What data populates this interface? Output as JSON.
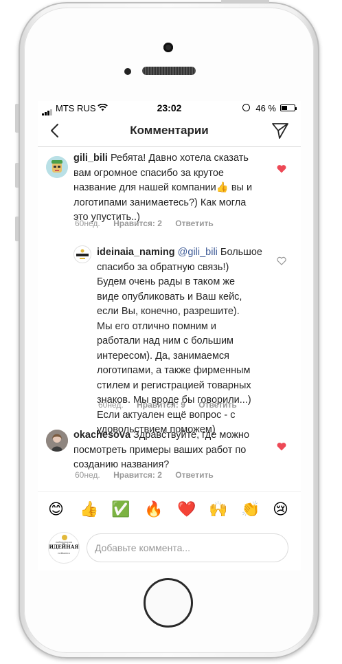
{
  "status": {
    "carrier": "MTS RUS",
    "time": "23:02",
    "battery_pct": "46 %",
    "battery_level": 0.46
  },
  "nav": {
    "title": "Комментарии",
    "back_icon": "chevron-left-icon",
    "send_icon": "paper-plane-icon"
  },
  "comments": [
    {
      "username": "gili_bili",
      "text_lines": [
        "Ребята! Давно хотела сказать",
        "вам огромное спасибо за крутое",
        "название для нашей компании",
        "логотипами занимаетесь?) Как могла",
        "это упустить..)"
      ],
      "line3_suffix": " вы и",
      "emoji": "👍",
      "age": "60нед.",
      "likes": "Нравится: 2",
      "reply": "Ответить",
      "liked": true
    },
    {
      "username": "ideinaia_naming",
      "mention": "@gili_bili",
      "first_line_rest": " Большое",
      "text_lines": [
        "спасибо за обратную связь!)",
        "Будем очень рады в таком же",
        "виде опубликовать и Ваш кейс,",
        "если Вы, конечно, разрешите).",
        "Мы его отлично помним и",
        "работали над ним с большим",
        "интересом). Да, занимаемся",
        "логотипами, а также фирменным",
        "стилем и регистрацией товарных",
        "знаков. Мы вроде бы говорили...)",
        "Если актуален ещё вопрос - с",
        "удовольствием поможем)"
      ],
      "age": "60нед.",
      "likes": "Нравится: 9",
      "reply": "Ответить",
      "liked": false
    },
    {
      "username": "okachesova",
      "first_line_rest": " Здравствуйте, где можно",
      "text_lines": [
        "посмотреть примеры ваших работ по",
        "созданию названия?"
      ],
      "age": "60нед.",
      "likes": "Нравится: 2",
      "reply": "Ответить",
      "liked": true
    }
  ],
  "emoji_bar": [
    "😊",
    "👍",
    "✅",
    "🔥",
    "❤️",
    "🙌",
    "👏",
    "😢"
  ],
  "logo": {
    "top": "лаборатория",
    "main": "ИДЕЙНАЯ",
    "bottom": "нейминга"
  },
  "input": {
    "placeholder": "Добавьте коммента..."
  },
  "colors": {
    "heart_liked": "#ed4956",
    "mention": "#3d5a96",
    "meta": "#999999"
  }
}
